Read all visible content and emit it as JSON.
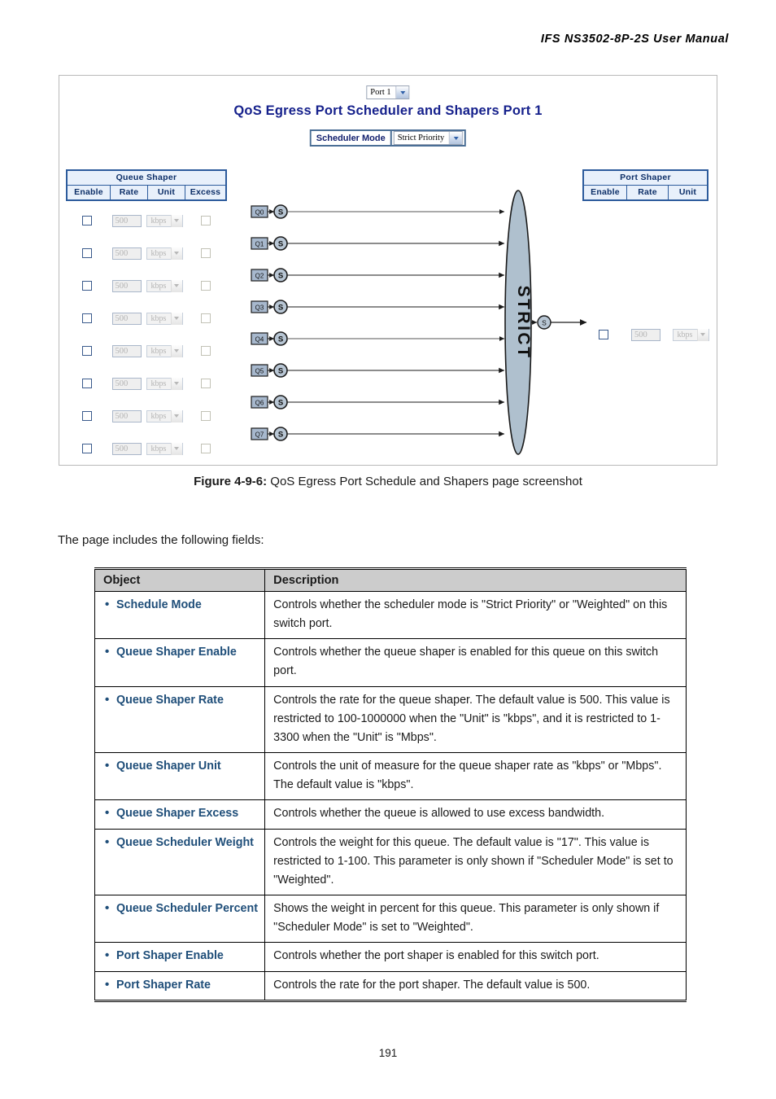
{
  "document": {
    "running_header": "IFS  NS3502-8P-2S  User  Manual",
    "page_number": "191",
    "figure_caption_label": "Figure 4-9-6:",
    "figure_caption_text": " QoS Egress Port Schedule and Shapers page screenshot",
    "intro_paragraph": "The page includes the following fields:"
  },
  "screenshot": {
    "port_selector": {
      "value": "Port 1"
    },
    "title": "QoS Egress Port Scheduler and Shapers  Port 1",
    "scheduler_mode": {
      "label": "Scheduler Mode",
      "value": "Strict Priority"
    },
    "queue_shaper_table": {
      "title": "Queue Shaper",
      "columns": [
        "Enable",
        "Rate",
        "Unit",
        "Excess"
      ],
      "rows": [
        {
          "enable": false,
          "rate": "500",
          "unit": "kbps",
          "excess": false
        },
        {
          "enable": false,
          "rate": "500",
          "unit": "kbps",
          "excess": false
        },
        {
          "enable": false,
          "rate": "500",
          "unit": "kbps",
          "excess": false
        },
        {
          "enable": false,
          "rate": "500",
          "unit": "kbps",
          "excess": false
        },
        {
          "enable": false,
          "rate": "500",
          "unit": "kbps",
          "excess": false
        },
        {
          "enable": false,
          "rate": "500",
          "unit": "kbps",
          "excess": false
        },
        {
          "enable": false,
          "rate": "500",
          "unit": "kbps",
          "excess": false
        },
        {
          "enable": false,
          "rate": "500",
          "unit": "kbps",
          "excess": false
        }
      ]
    },
    "port_shaper_table": {
      "title": "Port Shaper",
      "columns": [
        "Enable",
        "Rate",
        "Unit"
      ],
      "row": {
        "enable": false,
        "rate": "500",
        "unit": "kbps"
      }
    },
    "diagram": {
      "queues": [
        "Q0",
        "Q1",
        "Q2",
        "Q3",
        "Q4",
        "Q5",
        "Q6",
        "Q7"
      ],
      "shaper_node_label": "S",
      "scheduler_label": "STRICT",
      "output_node_label": "S",
      "colors": {
        "queue_box_fill": "#a7b8cd",
        "scheduler_fill": "#afc0ce",
        "node_fill": "#b8c6d4",
        "stroke": "#1a1a1a"
      }
    },
    "colors": {
      "title_blue": "#16218c",
      "table_border_blue": "#2c5b9c",
      "table_fill_blue": "#e8f0fb"
    }
  },
  "fields_table": {
    "headers": [
      "Object",
      "Description"
    ],
    "rows": [
      {
        "object": "Schedule Mode",
        "description": "Controls whether the scheduler mode is \"Strict Priority\" or \"Weighted\" on this switch port."
      },
      {
        "object": "Queue Shaper Enable",
        "description": "Controls whether the queue shaper is enabled for this queue on this switch port."
      },
      {
        "object": "Queue Shaper Rate",
        "description": "Controls the rate for the queue shaper. The default value is 500. This value is restricted to 100-1000000 when the \"Unit\" is \"kbps\", and it is restricted to 1-3300 when the \"Unit\" is \"Mbps\"."
      },
      {
        "object": "Queue Shaper Unit",
        "description": "Controls the unit of measure for the queue shaper rate as \"kbps\" or \"Mbps\". The default value is \"kbps\"."
      },
      {
        "object": "Queue Shaper Excess",
        "description": "Controls whether the queue is allowed to use excess bandwidth."
      },
      {
        "object": "Queue Scheduler Weight",
        "description": "Controls the weight for this queue. The default value is \"17\". This value is restricted to 1-100. This parameter is only shown if \"Scheduler Mode\" is set to \"Weighted\"."
      },
      {
        "object": "Queue Scheduler Percent",
        "description": "Shows the weight in percent for this queue. This parameter is only shown if \"Scheduler Mode\" is set to \"Weighted\"."
      },
      {
        "object": "Port Shaper Enable",
        "description": "Controls whether the port shaper is enabled for this switch port."
      },
      {
        "object": "Port Shaper Rate",
        "description": "Controls the rate for the port shaper. The default value is 500."
      }
    ]
  }
}
